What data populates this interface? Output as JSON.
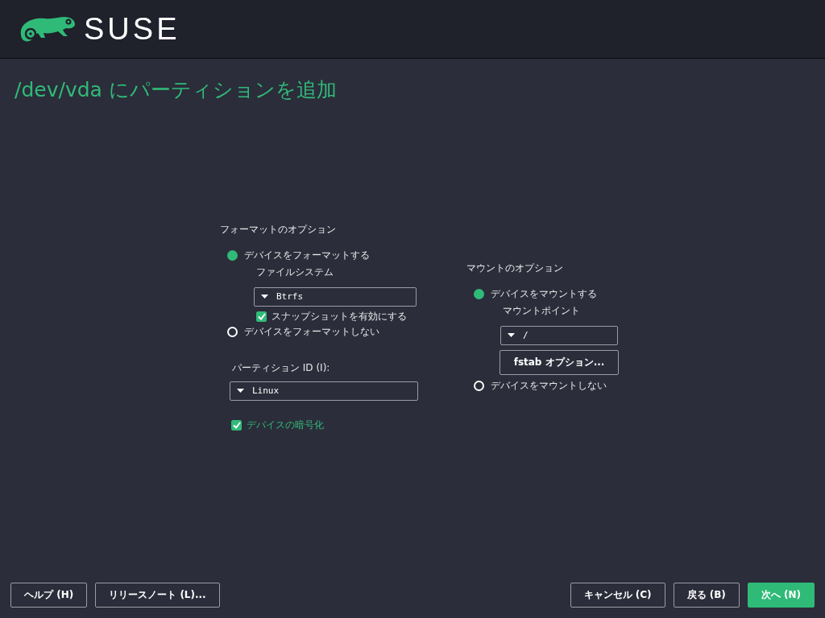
{
  "header": {
    "logo_text": "SUSE"
  },
  "title": "/dev/vda にパーティションを追加",
  "format_options": {
    "heading": "フォーマットのオプション",
    "radios": [
      {
        "label": "デバイスをフォーマットする",
        "selected": true
      },
      {
        "label": "デバイスをフォーマットしない",
        "selected": false
      }
    ],
    "filesystem": {
      "label": "ファイルシステム",
      "value": "Btrfs"
    },
    "snapshots": {
      "label": "スナップショットを有効にする",
      "checked": true
    },
    "partition_id": {
      "label": "パーティション ID (I):",
      "value": "Linux"
    },
    "encrypt": {
      "label": "デバイスの暗号化",
      "checked": true
    }
  },
  "mount_options": {
    "heading": "マウントのオプション",
    "radios": [
      {
        "label": "デバイスをマウントする",
        "selected": true
      },
      {
        "label": "デバイスをマウントしない",
        "selected": false
      }
    ],
    "mount_point": {
      "label": "マウントポイント",
      "value": "/"
    },
    "fstab_button": "fstab オプション..."
  },
  "footer": {
    "left": [
      {
        "label": "ヘルプ (H)",
        "kind": "normal"
      },
      {
        "label": "リリースノート (L)...",
        "kind": "normal"
      }
    ],
    "right": [
      {
        "label": "キャンセル (C)",
        "kind": "normal"
      },
      {
        "label": "戻る (B)",
        "kind": "normal"
      },
      {
        "label": "次へ (N)",
        "kind": "primary"
      }
    ]
  }
}
